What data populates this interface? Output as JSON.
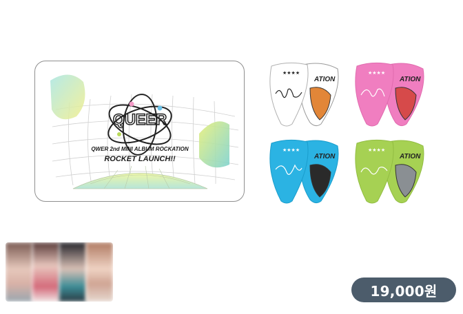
{
  "product_card": {
    "logo_text": "QUEER",
    "subtitle": "QWER 2nd MINI ALBUM ROCKATION",
    "title": "ROCKET LAUNCH!!"
  },
  "picks": [
    {
      "color": "#ffffff",
      "stars": "★★★★",
      "back_text": "ATION"
    },
    {
      "color": "#f07ec0",
      "stars": "★★★★",
      "back_text": "ATION"
    },
    {
      "color": "#2bb3e3",
      "stars": "★★★★",
      "back_text": "ATION"
    },
    {
      "color": "#a6d153",
      "stars": "★★★★",
      "back_text": "ATION"
    }
  ],
  "price": "19,000원"
}
